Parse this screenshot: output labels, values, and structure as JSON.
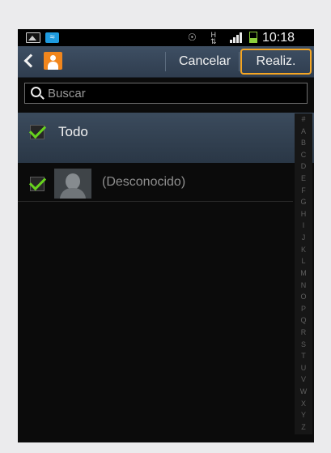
{
  "status_bar": {
    "time": "10:18",
    "icons": [
      "gallery-icon",
      "wifi-icon",
      "eye-icon",
      "data-icon",
      "signal-icon",
      "battery-icon"
    ],
    "data_indicator": "H"
  },
  "action_bar": {
    "cancel_label": "Cancelar",
    "done_label": "Realiz.",
    "highlight_color": "#f6a623"
  },
  "search": {
    "placeholder": "Buscar"
  },
  "select_all": {
    "label": "Todo",
    "checked": true
  },
  "contacts": [
    {
      "name": "(Desconocido)",
      "checked": true
    }
  ],
  "index_letters": [
    "#",
    "A",
    "B",
    "C",
    "D",
    "E",
    "F",
    "G",
    "H",
    "I",
    "J",
    "K",
    "L",
    "M",
    "N",
    "O",
    "P",
    "Q",
    "R",
    "S",
    "T",
    "U",
    "V",
    "W",
    "X",
    "Y",
    "Z"
  ],
  "colors": {
    "check_green": "#67d31d",
    "contacts_orange": "#f1861d"
  }
}
